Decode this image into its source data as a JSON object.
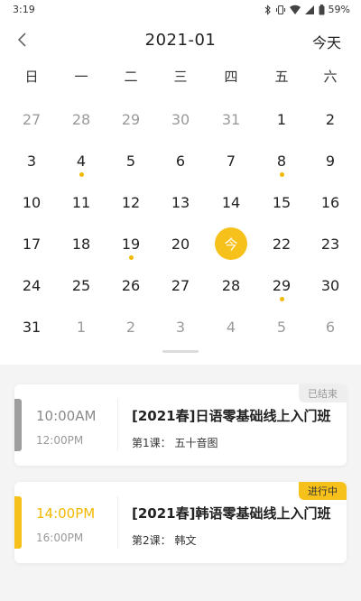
{
  "status": {
    "time": "3:19",
    "battery": "59%"
  },
  "header": {
    "back_icon": "chevron-left-icon",
    "title": "2021-01",
    "today_label": "今天"
  },
  "weekdays": [
    "日",
    "一",
    "二",
    "三",
    "四",
    "五",
    "六"
  ],
  "days": [
    [
      {
        "label": "27",
        "muted": true
      },
      {
        "label": "28",
        "muted": true
      },
      {
        "label": "29",
        "muted": true
      },
      {
        "label": "30",
        "muted": true
      },
      {
        "label": "31",
        "muted": true
      },
      {
        "label": "1"
      },
      {
        "label": "2"
      }
    ],
    [
      {
        "label": "3"
      },
      {
        "label": "4",
        "dot": true
      },
      {
        "label": "5"
      },
      {
        "label": "6"
      },
      {
        "label": "7"
      },
      {
        "label": "8",
        "dot": true
      },
      {
        "label": "9"
      }
    ],
    [
      {
        "label": "10"
      },
      {
        "label": "11"
      },
      {
        "label": "12"
      },
      {
        "label": "13"
      },
      {
        "label": "14"
      },
      {
        "label": "15"
      },
      {
        "label": "16"
      }
    ],
    [
      {
        "label": "17"
      },
      {
        "label": "18"
      },
      {
        "label": "19",
        "dot": true
      },
      {
        "label": "20"
      },
      {
        "label": "今",
        "today": true
      },
      {
        "label": "22"
      },
      {
        "label": "23"
      }
    ],
    [
      {
        "label": "24"
      },
      {
        "label": "25"
      },
      {
        "label": "26"
      },
      {
        "label": "27"
      },
      {
        "label": "28"
      },
      {
        "label": "29",
        "dot": true
      },
      {
        "label": "30"
      }
    ],
    [
      {
        "label": "31"
      },
      {
        "label": "1",
        "muted": true
      },
      {
        "label": "2",
        "muted": true
      },
      {
        "label": "3",
        "muted": true
      },
      {
        "label": "4",
        "muted": true
      },
      {
        "label": "5",
        "muted": true
      },
      {
        "label": "6",
        "muted": true
      }
    ]
  ],
  "courses": [
    {
      "start": "10:00AM",
      "end": "12:00PM",
      "title": "[2021春]日语零基础线上入门班",
      "lesson": "第1课：  五十音图",
      "status": "已结束"
    },
    {
      "start": "14:00PM",
      "end": "16:00PM",
      "title": "[2021春]韩语零基础线上入门班",
      "lesson": "第2课：  韩文",
      "status": "进行中"
    }
  ],
  "colors": {
    "accent": "#f7c11b",
    "finished": "#9e9e9e"
  }
}
